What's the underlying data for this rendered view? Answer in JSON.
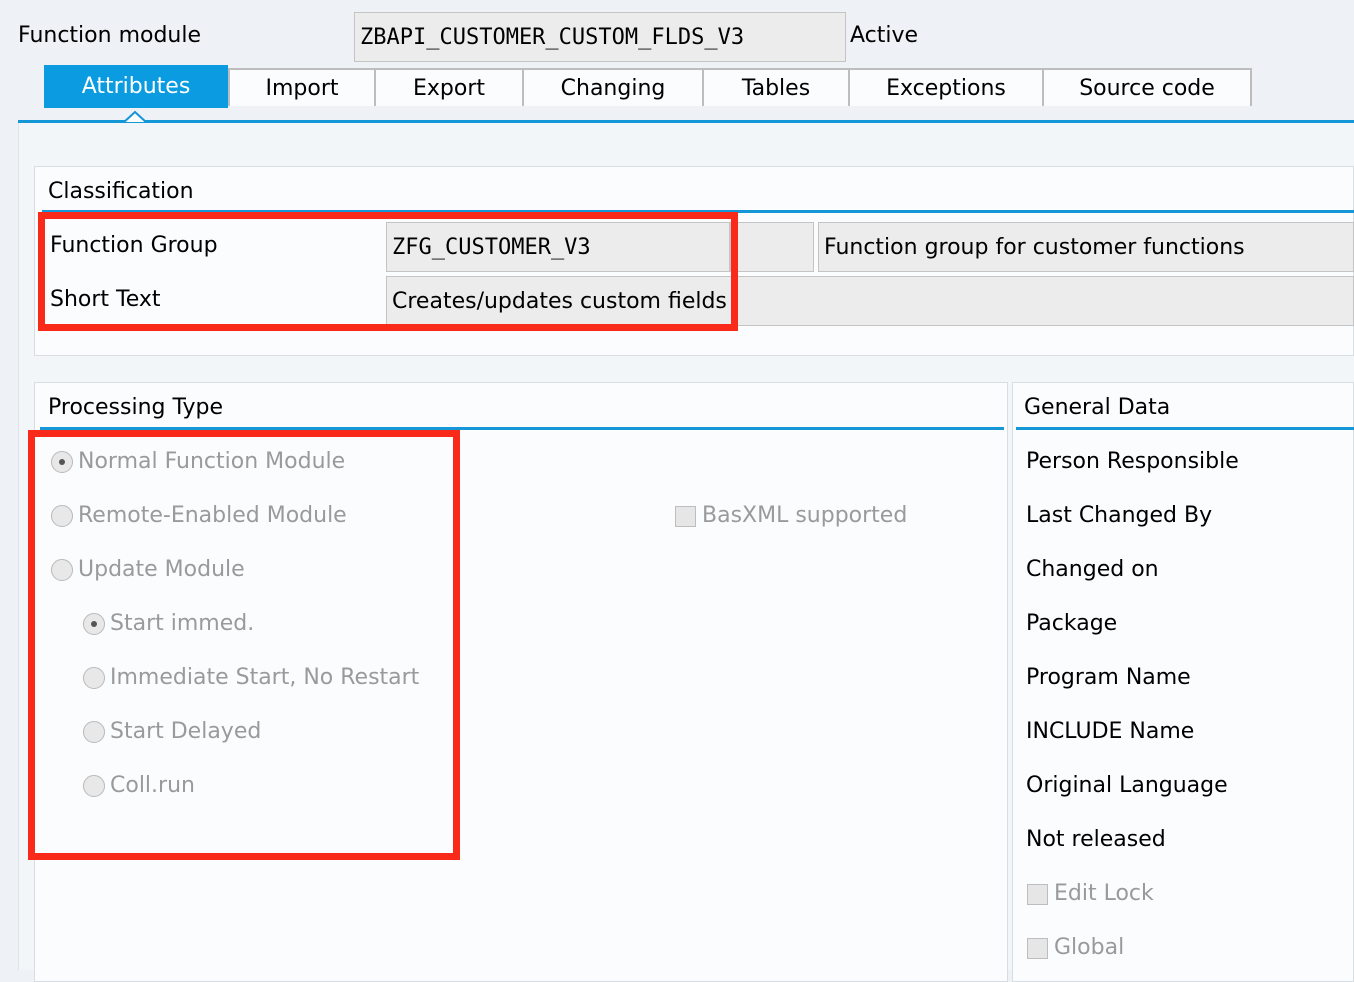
{
  "header": {
    "label": "Function module",
    "module_name": "ZBAPI_CUSTOMER_CUSTOM_FLDS_V3",
    "status": "Active"
  },
  "tabs": [
    {
      "label": "Attributes",
      "active": true
    },
    {
      "label": "Import"
    },
    {
      "label": "Export"
    },
    {
      "label": "Changing"
    },
    {
      "label": "Tables"
    },
    {
      "label": "Exceptions"
    },
    {
      "label": "Source code"
    }
  ],
  "classification": {
    "title": "Classification",
    "function_group_label": "Function Group",
    "function_group_value": "ZFG_CUSTOMER_V3",
    "function_group_description": "Function group for customer functions",
    "short_text_label": "Short Text",
    "short_text_value": "Creates/updates custom fields"
  },
  "processing_type": {
    "title": "Processing Type",
    "options": [
      {
        "label": "Normal Function Module",
        "checked": true
      },
      {
        "label": "Remote-Enabled Module",
        "checked": false
      },
      {
        "label": "Update Module",
        "checked": false
      }
    ],
    "update_options": [
      {
        "label": "Start immed.",
        "checked": true
      },
      {
        "label": "Immediate Start, No Restart",
        "checked": false
      },
      {
        "label": "Start Delayed",
        "checked": false
      },
      {
        "label": "Coll.run",
        "checked": false
      }
    ],
    "basxml_label": "BasXML supported"
  },
  "general_data": {
    "title": "General Data",
    "fields": [
      "Person Responsible",
      "Last Changed By",
      "Changed on",
      "Package",
      "Program Name",
      "INCLUDE Name",
      "Original Language",
      "Not released"
    ],
    "edit_lock_label": "Edit Lock",
    "global_label": "Global"
  },
  "colors": {
    "accent": "#0a9be0",
    "highlight": "#fa2a1b",
    "field_bg": "#ececec"
  }
}
